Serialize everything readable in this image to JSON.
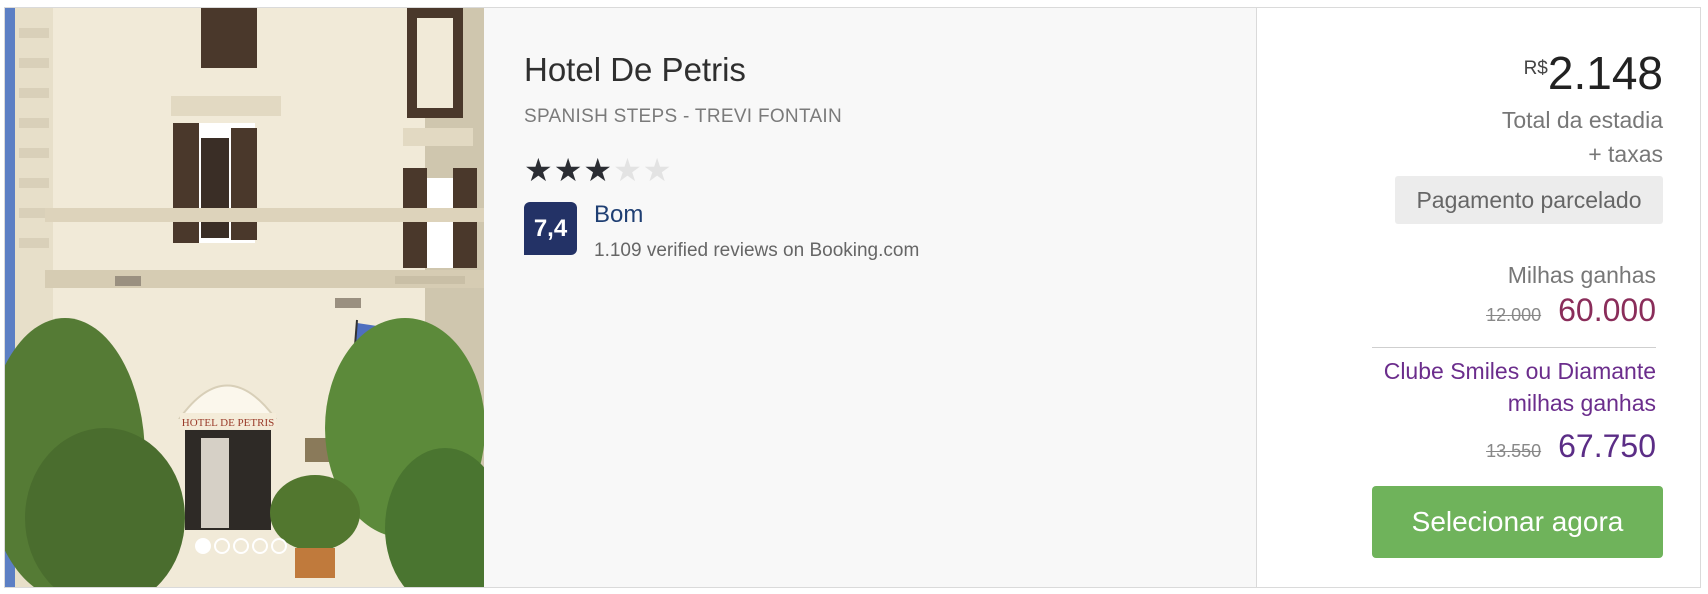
{
  "hotel": {
    "name": "Hotel De Petris",
    "location": "SPANISH STEPS - TREVI FONTAIN",
    "stars_filled": 3,
    "stars_total": 5,
    "score": "7,4",
    "rating_word": "Bom",
    "reviews": "1.109 verified reviews on Booking.com",
    "photo_sign": "HOTEL DE PETRIS"
  },
  "gallery": {
    "total_photos": 5,
    "active_index": 0
  },
  "pricing": {
    "currency": "R$",
    "amount": "2.148",
    "total_label": "Total da estadia",
    "taxes_label": "+ taxas",
    "installment_label": "Pagamento parcelado",
    "miles_label": "Milhas ganhas",
    "miles_old": "12.000",
    "miles_new": "60.000",
    "club_label_line1": "Clube Smiles ou Diamante",
    "club_label_line2": "milhas ganhas",
    "club_miles_old": "13.550",
    "club_miles_new": "67.750",
    "select_label": "Selecionar agora"
  },
  "colors": {
    "score_bg": "#233266",
    "select_button": "#6fb35b",
    "miles_accent": "#8a2d5a",
    "club_accent": "#5b2d86"
  },
  "icons": {
    "star": "star-icon",
    "dot": "carousel-dot-icon"
  }
}
